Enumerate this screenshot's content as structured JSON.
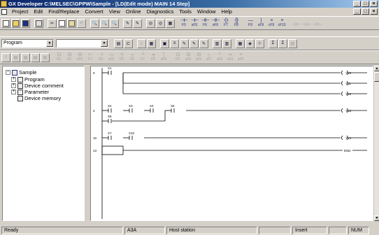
{
  "window": {
    "title": "GX Developer C:\\MELSEC\\GPPW\\Sample - [LD(Edit mode)     MAIN     14 Step]",
    "minimize": "_",
    "maximize": "□",
    "close": "×"
  },
  "menu": {
    "items": [
      "Project",
      "Edit",
      "Find/Replace",
      "Convert",
      "View",
      "Online",
      "Diagnostics",
      "Tools",
      "Window",
      "Help"
    ]
  },
  "toolbar2": {
    "data_type_value": "Program",
    "device_value": ""
  },
  "fkeys_row1": [
    {
      "sym": "⊣⊢",
      "key": "F5"
    },
    {
      "sym": "⊣⊢",
      "key": "sF5"
    },
    {
      "sym": "⊣/⊢",
      "key": "F6"
    },
    {
      "sym": "⊣/⊢",
      "key": "sF6"
    },
    {
      "sym": "-( )-",
      "key": "F7"
    },
    {
      "sym": "-[ ]-",
      "key": "F8"
    },
    {
      "sym": "—",
      "key": "F9"
    },
    {
      "sym": "|",
      "key": "sF9"
    },
    {
      "sym": "×",
      "key": "cF9"
    },
    {
      "sym": "×",
      "key": "cF10"
    }
  ],
  "tree": {
    "root": "Sample",
    "items": [
      "Program",
      "Device comment",
      "Parameter",
      "Device memory"
    ]
  },
  "ladder": {
    "rungs": [
      {
        "step": "0",
        "contacts": [
          "X1"
        ],
        "coils": [
          "Y10",
          "Y11",
          "Y12"
        ]
      },
      {
        "step": "4",
        "contacts": [
          "X2",
          "X3",
          "X4",
          "X5"
        ],
        "parallel": [
          "X6"
        ],
        "coils": [
          "Y13"
        ]
      },
      {
        "step": "10",
        "contacts": [
          "X7",
          "X10"
        ],
        "coils": [
          "Y14"
        ]
      },
      {
        "step": "13",
        "contacts": [],
        "coils": [
          "END"
        ]
      }
    ]
  },
  "status": {
    "state": "Ready",
    "cpu": "A3A",
    "station": "Host station",
    "mode": "Insert",
    "numlock": "NUM"
  }
}
